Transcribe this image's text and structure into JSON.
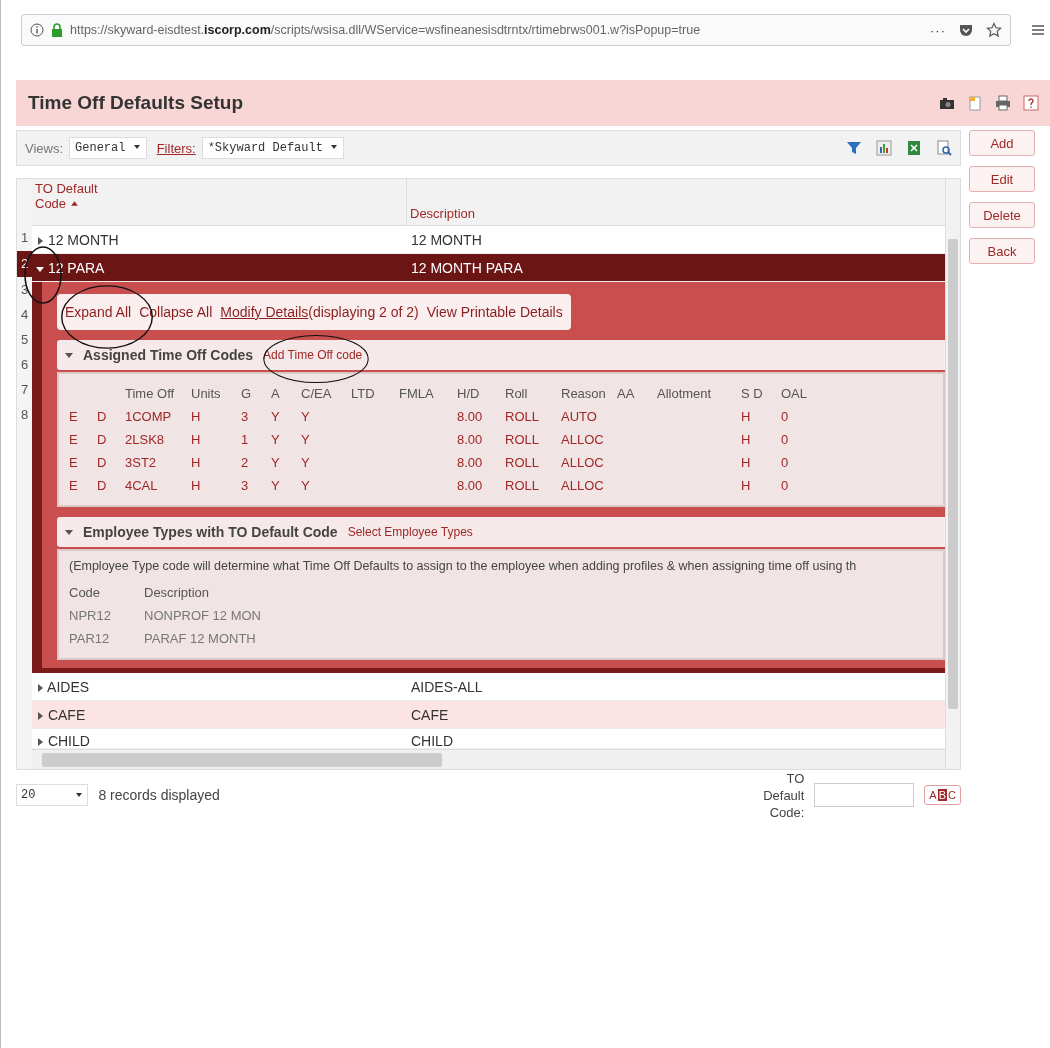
{
  "browser": {
    "url_prefix": "https://skyward-eisdtest.",
    "url_domain": "iscorp.com",
    "url_path": "/scripts/wsisa.dll/WService=wsfineanesisdtrntx/rtimebrws001.w?isPopup=true",
    "more": "···"
  },
  "title": "Time Off Defaults Setup",
  "toolbar": {
    "views_label": "Views:",
    "view": "General",
    "filters_label": "Filters:",
    "filter": "*Skyward Default"
  },
  "side_buttons": [
    "Add",
    "Edit",
    "Delete",
    "Back"
  ],
  "grid": {
    "columns": [
      {
        "label": "TO Default Code",
        "sorted": true
      },
      {
        "label": "Description",
        "sorted": false
      }
    ],
    "row_numbers": [
      "1",
      "2",
      "3",
      "4",
      "5",
      "6",
      "7",
      "8"
    ],
    "rows": [
      {
        "code": "12 MONTH",
        "description": "12 MONTH",
        "expanded": false,
        "selected": false
      },
      {
        "code": "12 PARA",
        "description": "12 MONTH PARA",
        "expanded": true,
        "selected": true
      },
      {
        "code": "AIDES",
        "description": "AIDES-ALL",
        "expanded": false,
        "selected": false
      },
      {
        "code": "CAFE",
        "description": "CAFE",
        "expanded": false,
        "selected": false
      },
      {
        "code": "CHILD",
        "description": "CHILD",
        "expanded": false,
        "selected": false
      }
    ]
  },
  "details": {
    "actions": [
      {
        "label": "Expand All"
      },
      {
        "label": "Collapse All"
      },
      {
        "label": "Modify Details",
        "note": "(displaying 2 of 2)"
      },
      {
        "label": "View Printable Details"
      }
    ],
    "assigned": {
      "title": "Assigned Time Off Codes",
      "link": "Add Time Off code",
      "columns": [
        "",
        "",
        "Time Off",
        "Units",
        "G",
        "A",
        "C/EA",
        "LTD",
        "FMLA",
        "H/D",
        "Roll",
        "Reason",
        "AA",
        "Allotment",
        "S D",
        "OAL"
      ],
      "rows": [
        [
          "E",
          "D",
          "1COMP",
          "H",
          "3",
          "Y",
          "Y",
          "",
          "",
          "8.00",
          "ROLL",
          "AUTO",
          "",
          "",
          "H",
          "0"
        ],
        [
          "E",
          "D",
          "2LSK8",
          "H",
          "1",
          "Y",
          "Y",
          "",
          "",
          "8.00",
          "ROLL",
          "ALLOC",
          "",
          "",
          "H",
          "0"
        ],
        [
          "E",
          "D",
          "3ST2",
          "H",
          "2",
          "Y",
          "Y",
          "",
          "",
          "8.00",
          "ROLL",
          "ALLOC",
          "",
          "",
          "H",
          "0"
        ],
        [
          "E",
          "D",
          "4CAL",
          "H",
          "3",
          "Y",
          "Y",
          "",
          "",
          "8.00",
          "ROLL",
          "ALLOC",
          "",
          "",
          "H",
          "0"
        ]
      ]
    },
    "employee_types": {
      "title": "Employee Types with TO Default Code",
      "link": "Select Employee Types",
      "note": "(Employee Type code will determine what Time Off Defaults to assign to the employee when adding profiles & when assigning time off using th",
      "columns": [
        "Code",
        "Description"
      ],
      "rows": [
        [
          "NPR12",
          "NONPROF 12 MON"
        ],
        [
          "PAR12",
          "PARAF 12 MONTH"
        ]
      ]
    }
  },
  "footer": {
    "page_size": "20",
    "records": "8 records displayed",
    "search_label": "TO Default Code:",
    "abc": [
      "A",
      "B",
      "C"
    ]
  }
}
